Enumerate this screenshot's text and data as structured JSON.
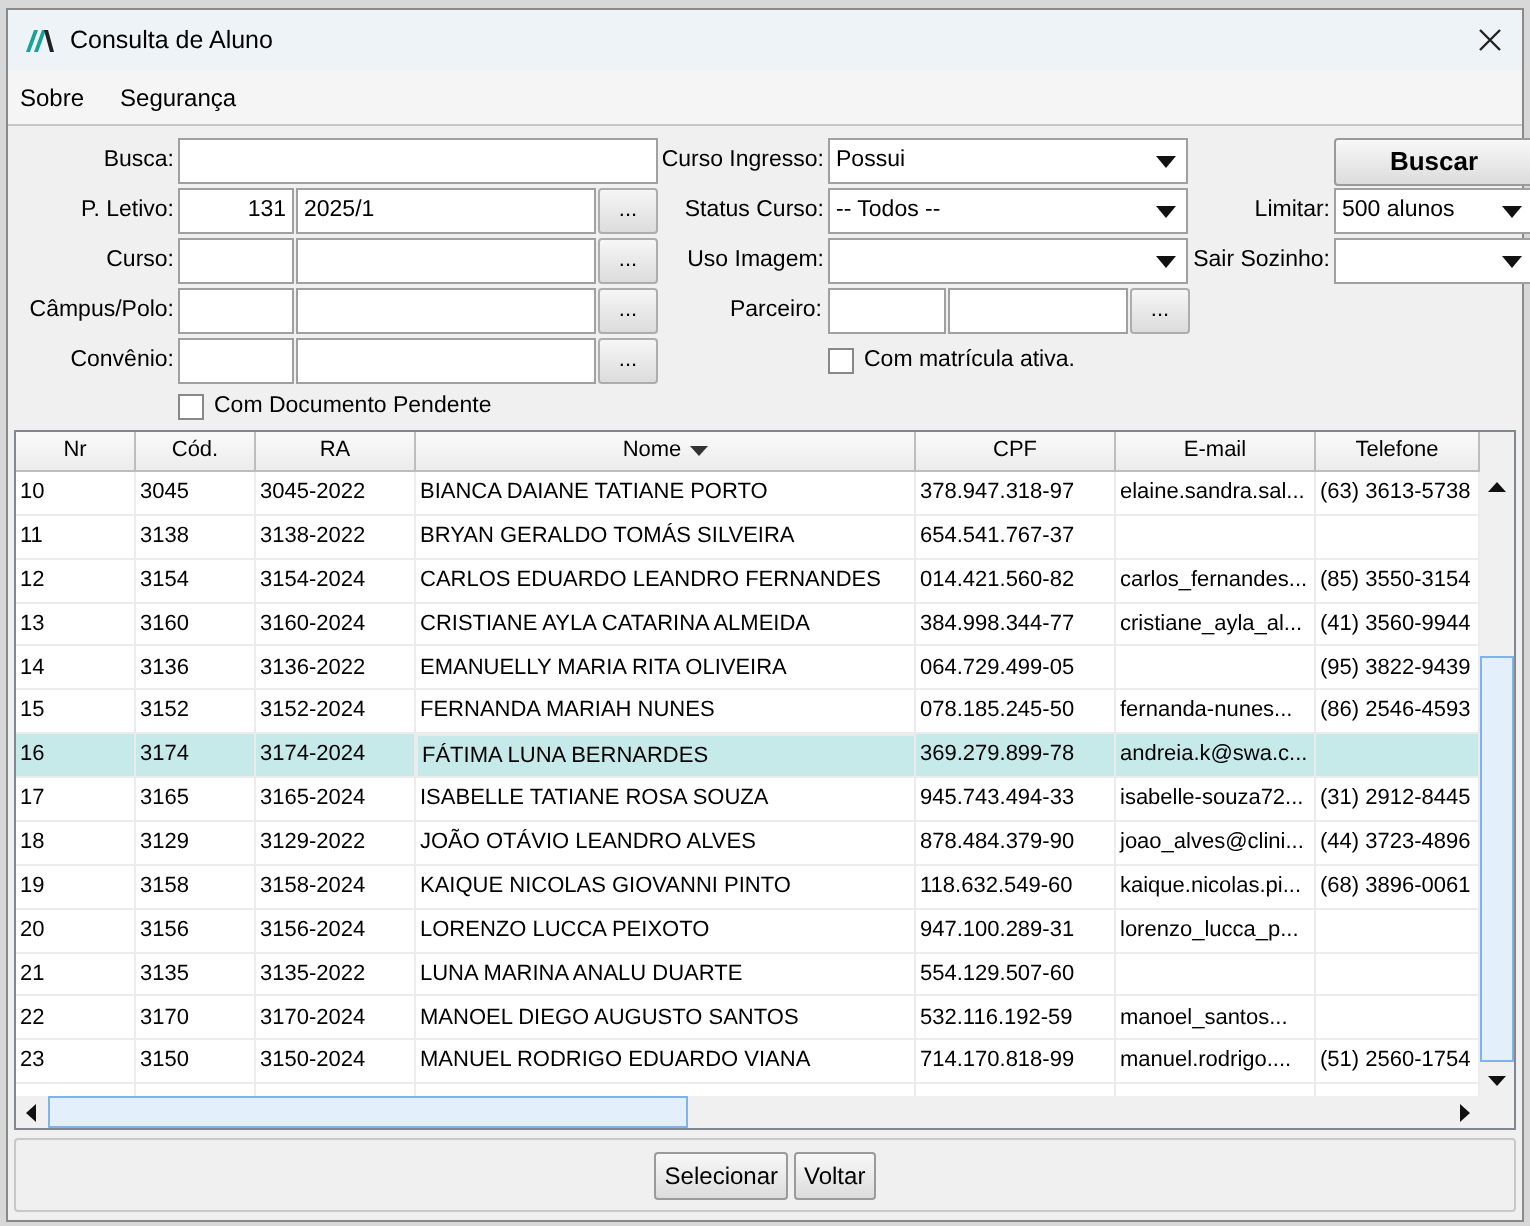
{
  "window": {
    "title": "Consulta de Aluno"
  },
  "menu": [
    "Sobre",
    "Segurança"
  ],
  "form": {
    "busca": {
      "label": "Busca:"
    },
    "periodo": {
      "label": "P. Letivo:",
      "code": "131",
      "value": "2025/1",
      "button": "..."
    },
    "curso": {
      "label": "Curso:",
      "button": "..."
    },
    "campus": {
      "label": "Câmpus/Polo:",
      "button": "..."
    },
    "convenio": {
      "label": "Convênio:",
      "button": "..."
    },
    "documento_pendente": {
      "label": "Com Documento Pendente",
      "checked": false
    },
    "curso_ingresso": {
      "label": "Curso Ingresso:",
      "value": "Possui"
    },
    "status_curso": {
      "label": "Status Curso:",
      "value": "-- Todos --"
    },
    "uso_imagem": {
      "label": "Uso Imagem:"
    },
    "parceiro": {
      "label": "Parceiro:",
      "button": "..."
    },
    "matricula_ativa": {
      "label": "Com matrícula ativa.",
      "checked": false
    },
    "buscar_button": "Buscar",
    "limitar": {
      "label": "Limitar:",
      "value": "500 alunos"
    },
    "sair_sozinho": {
      "label": "Sair Sozinho:"
    }
  },
  "table": {
    "columns": [
      {
        "label": "Nr",
        "sorted": false
      },
      {
        "label": "Cód.",
        "sorted": false
      },
      {
        "label": "RA",
        "sorted": false
      },
      {
        "label": "Nome",
        "sorted": true
      },
      {
        "label": "CPF",
        "sorted": false
      },
      {
        "label": "E-mail",
        "sorted": false
      },
      {
        "label": "Telefone",
        "sorted": false
      }
    ],
    "rows": [
      {
        "selected": false,
        "cells": [
          "10",
          "3045",
          "3045-2022",
          "BIANCA DAIANE TATIANE PORTO",
          "378.947.318-97",
          "elaine.sandra.sal...",
          "(63) 3613-5738"
        ]
      },
      {
        "selected": false,
        "cells": [
          "11",
          "3138",
          "3138-2022",
          "BRYAN GERALDO TOMÁS SILVEIRA",
          "654.541.767-37",
          "",
          ""
        ]
      },
      {
        "selected": false,
        "cells": [
          "12",
          "3154",
          "3154-2024",
          "CARLOS EDUARDO LEANDRO FERNANDES",
          "014.421.560-82",
          "carlos_fernandes...",
          "(85) 3550-3154"
        ]
      },
      {
        "selected": false,
        "cells": [
          "13",
          "3160",
          "3160-2024",
          "CRISTIANE AYLA CATARINA ALMEIDA",
          "384.998.344-77",
          "cristiane_ayla_al...",
          "(41) 3560-9944"
        ]
      },
      {
        "selected": false,
        "cells": [
          "14",
          "3136",
          "3136-2022",
          "EMANUELLY MARIA RITA OLIVEIRA",
          "064.729.499-05",
          "",
          "(95) 3822-9439"
        ]
      },
      {
        "selected": false,
        "cells": [
          "15",
          "3152",
          "3152-2024",
          "FERNANDA MARIAH NUNES",
          "078.185.245-50",
          "fernanda-nunes...",
          "(86) 2546-4593"
        ]
      },
      {
        "selected": true,
        "cells": [
          "16",
          "3174",
          "3174-2024",
          "FÁTIMA LUNA BERNARDES",
          "369.279.899-78",
          "andreia.k@swa.c...",
          ""
        ]
      },
      {
        "selected": false,
        "cells": [
          "17",
          "3165",
          "3165-2024",
          "ISABELLE TATIANE ROSA SOUZA",
          "945.743.494-33",
          "isabelle-souza72...",
          "(31) 2912-8445"
        ]
      },
      {
        "selected": false,
        "cells": [
          "18",
          "3129",
          "3129-2022",
          "JOÃO OTÁVIO LEANDRO ALVES",
          "878.484.379-90",
          "joao_alves@clini...",
          "(44) 3723-4896"
        ]
      },
      {
        "selected": false,
        "cells": [
          "19",
          "3158",
          "3158-2024",
          "KAIQUE NICOLAS GIOVANNI PINTO",
          "118.632.549-60",
          "kaique.nicolas.pi...",
          "(68) 3896-0061"
        ]
      },
      {
        "selected": false,
        "cells": [
          "20",
          "3156",
          "3156-2024",
          "LORENZO LUCCA PEIXOTO",
          "947.100.289-31",
          "lorenzo_lucca_p...",
          ""
        ]
      },
      {
        "selected": false,
        "cells": [
          "21",
          "3135",
          "3135-2022",
          "LUNA MARINA ANALU DUARTE",
          "554.129.507-60",
          "",
          ""
        ]
      },
      {
        "selected": false,
        "cells": [
          "22",
          "3170",
          "3170-2024",
          "MANOEL DIEGO AUGUSTO SANTOS",
          "532.116.192-59",
          "manoel_santos...",
          ""
        ]
      },
      {
        "selected": false,
        "cells": [
          "23",
          "3150",
          "3150-2024",
          "MANUEL RODRIGO EDUARDO VIANA",
          "714.170.818-99",
          "manuel.rodrigo....",
          "(51) 2560-1754"
        ]
      }
    ]
  },
  "buttons": [
    "Selecionar",
    "Voltar"
  ]
}
